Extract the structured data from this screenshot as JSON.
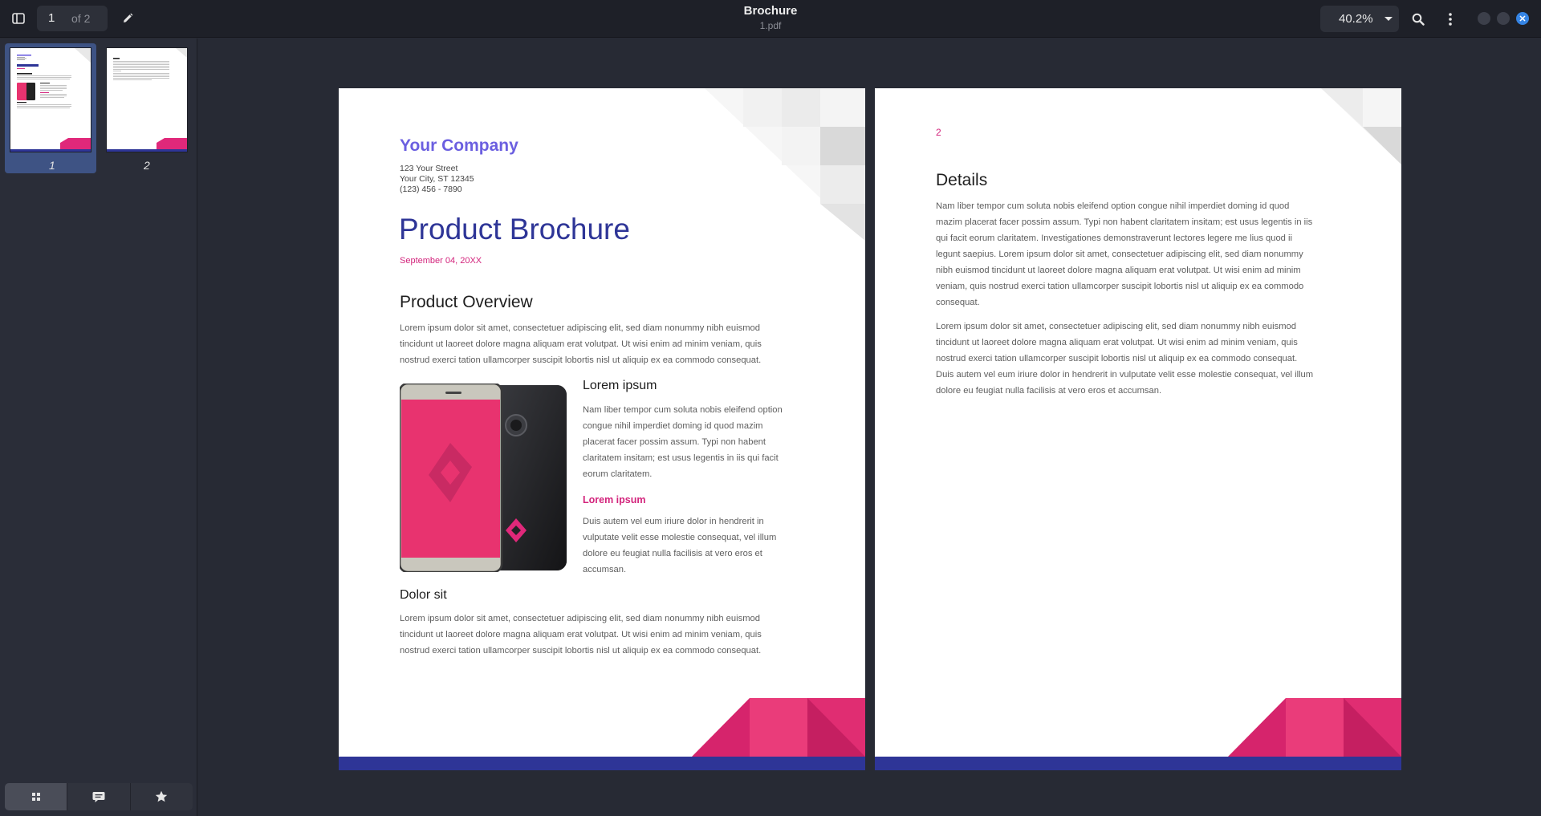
{
  "app": {
    "title": "Brochure",
    "subtitle": "1.pdf",
    "page_current": "1",
    "page_total": "of 2",
    "zoom": "40.2%"
  },
  "icons": {
    "sidebar_toggle": "sidebar-icon",
    "edit": "pencil-icon",
    "search": "search-icon",
    "menu": "kebab-menu-icon",
    "close": "close-icon",
    "thumbnails_tab": "grid-icon",
    "annotations_tab": "comment-icon",
    "bookmarks_tab": "star-icon"
  },
  "sidebar": {
    "thumbnails": [
      {
        "label": "1",
        "selected": true
      },
      {
        "label": "2",
        "selected": false
      }
    ]
  },
  "colors": {
    "accent_purple": "#6b5fe0",
    "navy": "#2e3597",
    "pink": "#e0287a",
    "magenta_text": "#d3247c",
    "window_close": "#3584e4"
  },
  "page1": {
    "company": "Your Company",
    "address": [
      "123 Your Street",
      "Your City, ST 12345",
      "(123) 456 - 7890"
    ],
    "title": "Product Brochure",
    "date": "September 04, 20XX",
    "overview_heading": "Product Overview",
    "overview_text": [
      "Lorem ipsum dolor sit amet, consectetuer adipiscing elit, sed diam nonummy nibh euismod",
      "tincidunt ut laoreet dolore magna aliquam erat volutpat. Ut wisi enim ad minim veniam, quis",
      "nostrud exerci tation ullamcorper suscipit lobortis nisl ut aliquip ex ea commodo consequat."
    ],
    "feature_heading": "Lorem ipsum",
    "feature_text": [
      "Nam liber tempor cum soluta nobis eleifend option",
      "congue nihil imperdiet doming id quod mazim",
      "placerat facer possim assum. Typi non habent",
      "claritatem insitam; est usus legentis in iis qui facit",
      "eorum claritatem."
    ],
    "sub_heading": "Lorem ipsum",
    "sub_text": [
      "Duis autem vel eum iriure dolor in hendrerit in",
      "vulputate velit esse molestie consequat, vel illum",
      "dolore eu feugiat nulla facilisis at vero eros et",
      "accumsan."
    ],
    "dolor_heading": "Dolor sit",
    "dolor_text": [
      "Lorem ipsum dolor sit amet, consectetuer adipiscing elit, sed diam nonummy nibh euismod",
      "tincidunt ut laoreet dolore magna aliquam erat volutpat. Ut wisi enim ad minim veniam, quis",
      "nostrud exerci tation ullamcorper suscipit lobortis nisl ut aliquip ex ea commodo consequat."
    ]
  },
  "page2": {
    "page_number": "2",
    "heading": "Details",
    "para1": [
      "Nam liber tempor cum soluta nobis eleifend option congue nihil imperdiet doming id quod",
      "mazim placerat facer possim assum. Typi non habent claritatem insitam; est usus legentis in iis",
      "qui facit eorum claritatem. Investigationes demonstraverunt lectores legere me lius quod ii",
      "legunt saepius. Lorem ipsum dolor sit amet, consectetuer adipiscing elit, sed diam nonummy",
      "nibh euismod tincidunt ut laoreet dolore magna aliquam erat volutpat. Ut wisi enim ad minim",
      "veniam, quis nostrud exerci tation ullamcorper suscipit lobortis nisl ut aliquip ex ea commodo",
      "consequat."
    ],
    "para2": [
      "Lorem ipsum dolor sit amet, consectetuer adipiscing elit, sed diam nonummy nibh euismod",
      "tincidunt ut laoreet dolore magna aliquam erat volutpat. Ut wisi enim ad minim veniam, quis",
      "nostrud exerci tation ullamcorper suscipit lobortis nisl ut aliquip ex ea commodo consequat.",
      "Duis autem vel eum iriure dolor in hendrerit in vulputate velit esse molestie consequat, vel illum",
      "dolore eu feugiat nulla facilisis at vero eros et accumsan."
    ]
  }
}
